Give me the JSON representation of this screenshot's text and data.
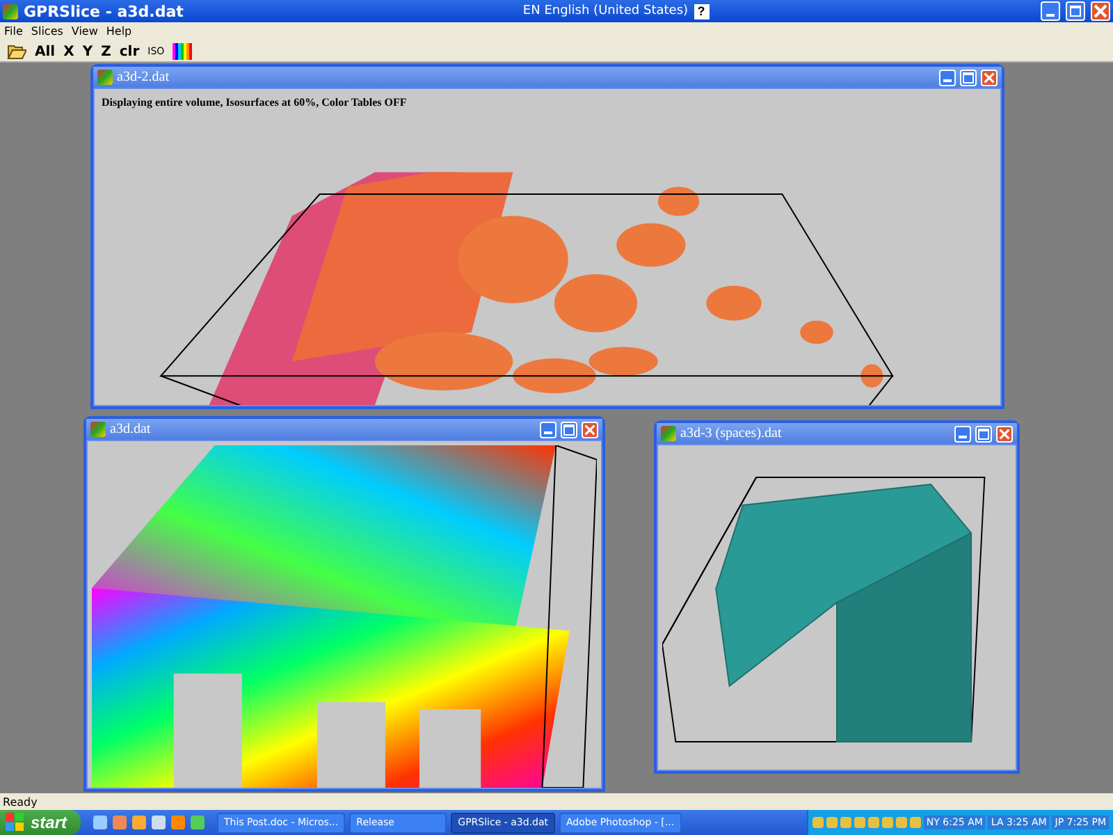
{
  "window": {
    "title": "GPRSlice - a3d.dat"
  },
  "language_bar": {
    "label": "EN English (United States)",
    "help": "?"
  },
  "menu": [
    "File",
    "Slices",
    "View",
    "Help"
  ],
  "toolbar": [
    {
      "kind": "open"
    },
    {
      "kind": "text",
      "label": "All"
    },
    {
      "kind": "text",
      "label": "X"
    },
    {
      "kind": "text",
      "label": "Y"
    },
    {
      "kind": "text",
      "label": "Z"
    },
    {
      "kind": "text",
      "label": "clr"
    },
    {
      "kind": "small",
      "label": "ISO"
    },
    {
      "kind": "colors"
    }
  ],
  "documents": [
    {
      "title": "a3d-2.dat",
      "kind": "isosurface",
      "caption": "Displaying entire volume, Isosurfaces at 60%, Color Tables OFF"
    },
    {
      "title": "a3d.dat",
      "kind": "slices"
    },
    {
      "title": "a3d-3 (spaces).dat",
      "kind": "volume"
    }
  ],
  "status_bar": {
    "text": "Ready"
  },
  "taskbar": {
    "start": "start",
    "tasks": [
      {
        "label": "This Post.doc - Micros...",
        "selected": false
      },
      {
        "label": "Release",
        "selected": false
      },
      {
        "label": "GPRSlice - a3d.dat",
        "selected": true
      },
      {
        "label": "Adobe Photoshop - [...",
        "selected": false
      }
    ],
    "clocks": [
      "NY 6:25 AM",
      "LA 3:25 AM",
      "JP 7:25 PM"
    ]
  }
}
